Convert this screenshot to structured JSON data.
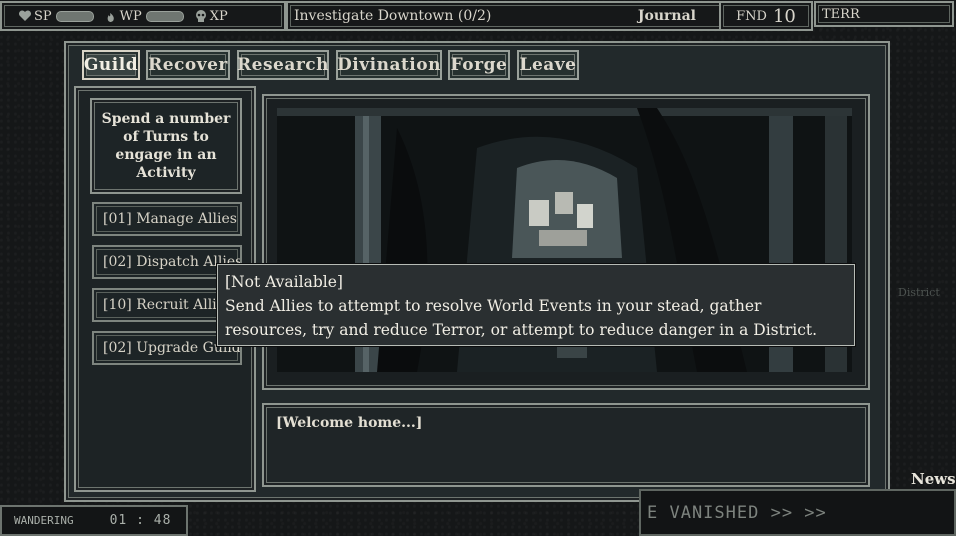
{
  "hud": {
    "sp_label": "SP",
    "wp_label": "WP",
    "xp_label": "XP",
    "quest": "Investigate Downtown (0/2)",
    "journal": "Journal",
    "fnd_label": "FND",
    "fnd_value": "10",
    "terr_label": "TERR"
  },
  "tabs": [
    "Guild",
    "Recover",
    "Research",
    "Divination",
    "Forge",
    "Leave"
  ],
  "guild": {
    "description": "Spend a number of Turns to engage in an Activity",
    "activities": [
      "[01] Manage Allies",
      "[02] Dispatch Allies",
      "[10] Recruit Allies",
      "[02] Upgrade Guild"
    ]
  },
  "tooltip": {
    "status": "[Not Available]",
    "text": "Send Allies to attempt to resolve World Events in your stead, gather resources, try and reduce Terror, or attempt to reduce danger in a District."
  },
  "dialog": "[Welcome home...]",
  "status_bar": {
    "mode": "WANDERING",
    "time": "01 : 48",
    "ticker": "E VANISHED >> >>",
    "news": "News"
  },
  "background": {
    "district_label": "District"
  },
  "colors": {
    "frame": "#8f9690",
    "panel": "#22292b",
    "text": "#e6e3d8"
  }
}
